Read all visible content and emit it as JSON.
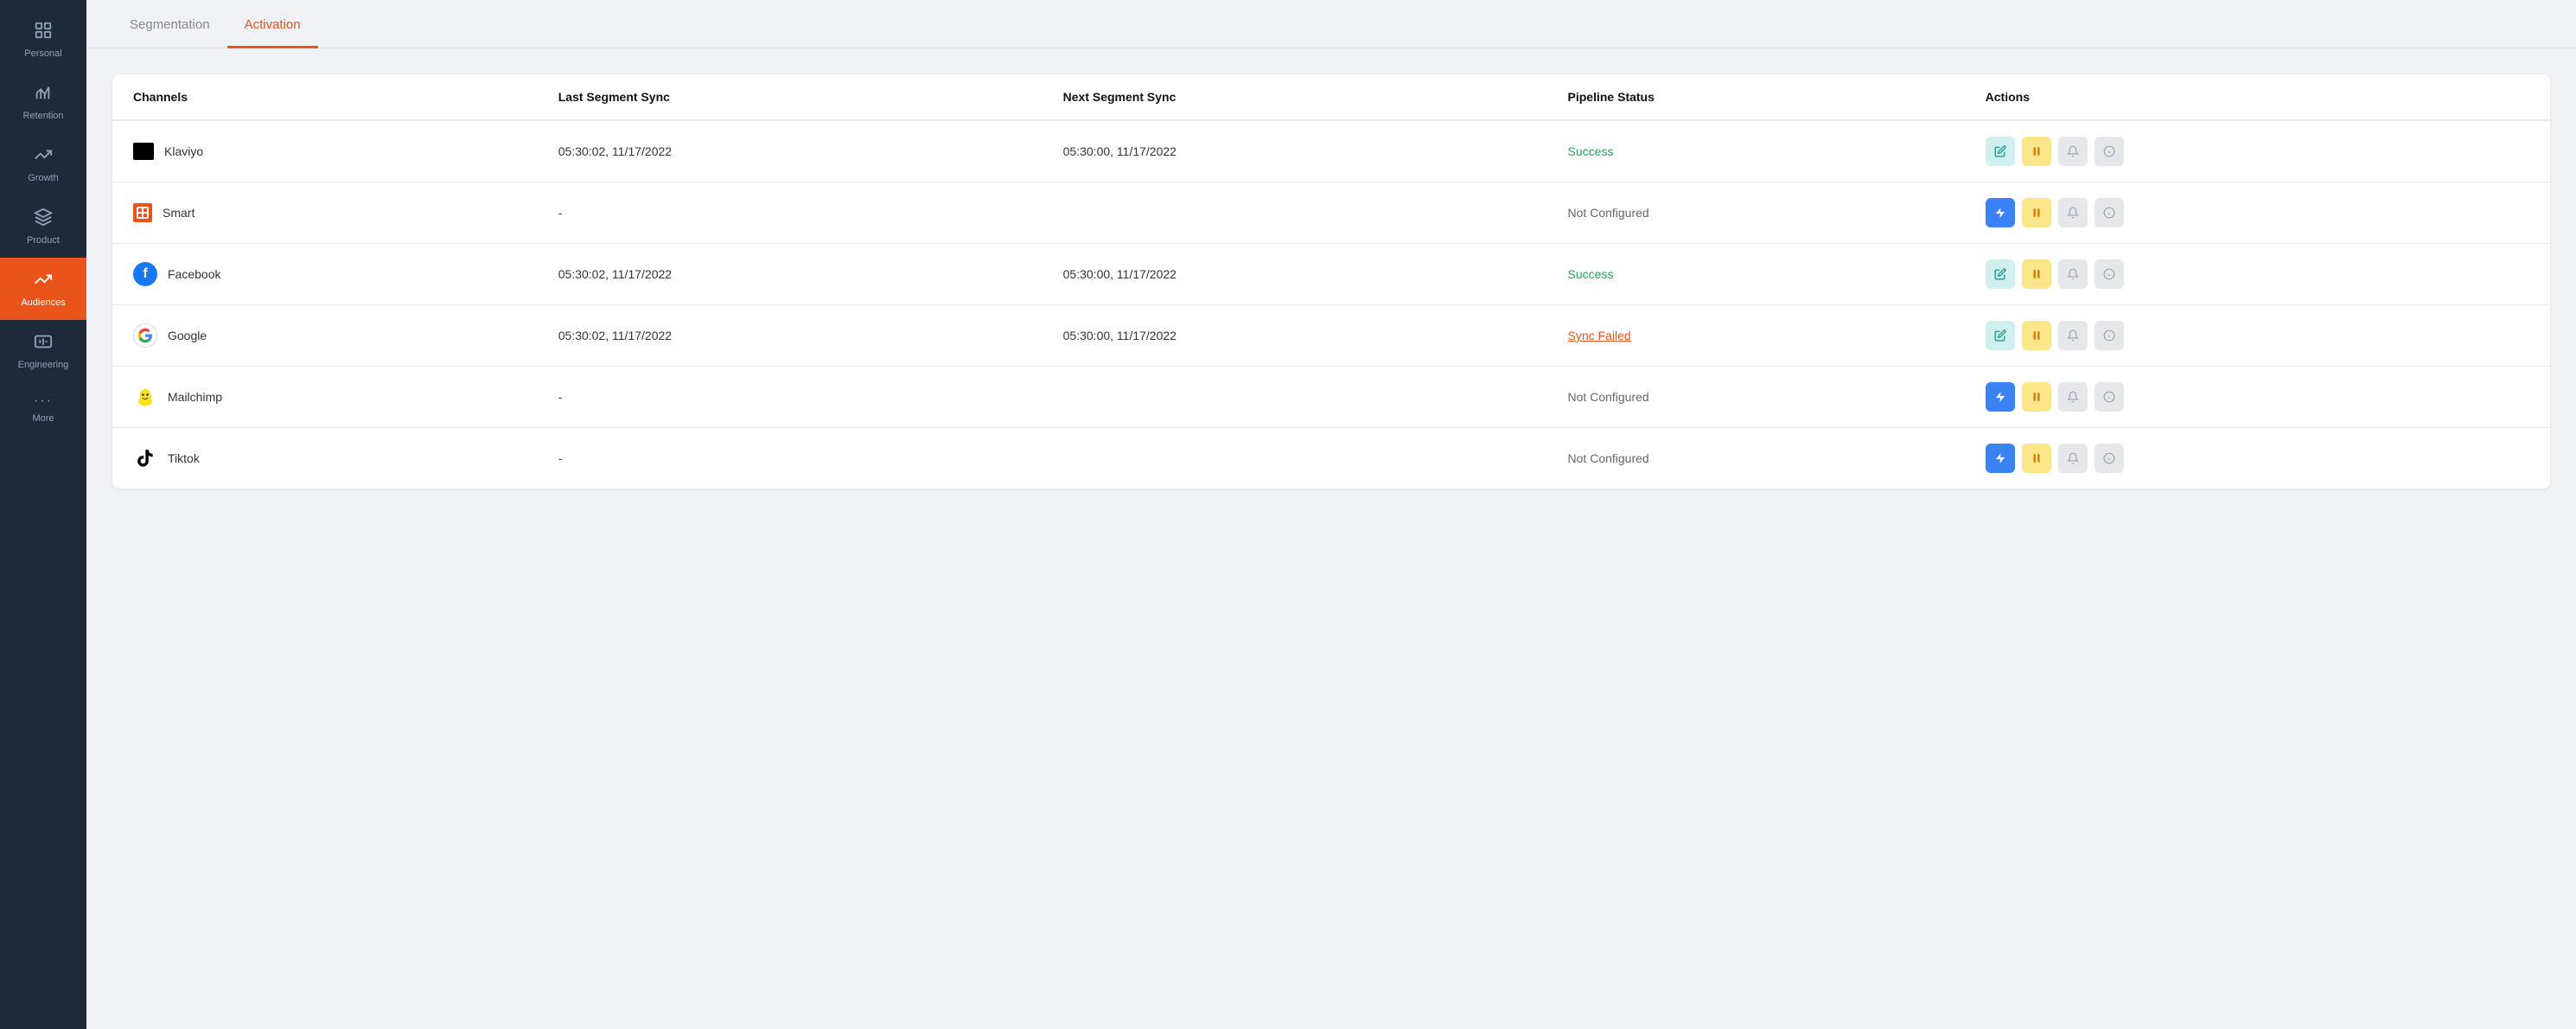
{
  "sidebar": {
    "items": [
      {
        "id": "personal",
        "label": "Personal",
        "icon": "⊞",
        "active": false
      },
      {
        "id": "retention",
        "label": "Retention",
        "icon": "📊",
        "active": false
      },
      {
        "id": "growth",
        "label": "Growth",
        "icon": "📈",
        "active": false
      },
      {
        "id": "product",
        "label": "Product",
        "icon": "🔧",
        "active": false
      },
      {
        "id": "audiences",
        "label": "Audiences",
        "icon": "↗",
        "active": true
      },
      {
        "id": "engineering",
        "label": "Engineering",
        "icon": "⚙",
        "active": false
      },
      {
        "id": "more",
        "label": "More",
        "icon": "···",
        "active": false
      }
    ]
  },
  "tabs": [
    {
      "id": "segmentation",
      "label": "Segmentation",
      "active": false
    },
    {
      "id": "activation",
      "label": "Activation",
      "active": true
    }
  ],
  "table": {
    "columns": [
      {
        "id": "channels",
        "label": "Channels"
      },
      {
        "id": "last_sync",
        "label": "Last Segment Sync"
      },
      {
        "id": "next_sync",
        "label": "Next Segment Sync"
      },
      {
        "id": "pipeline_status",
        "label": "Pipeline Status"
      },
      {
        "id": "actions",
        "label": "Actions"
      }
    ],
    "rows": [
      {
        "channel": "Klaviyo",
        "channel_type": "klaviyo",
        "last_sync": "05:30:02, 11/17/2022",
        "next_sync": "05:30:00, 11/17/2022",
        "status": "Success",
        "status_type": "success",
        "actions": [
          "edit",
          "pause",
          "bell",
          "info"
        ]
      },
      {
        "channel": "Smart",
        "channel_type": "smart",
        "last_sync": "-",
        "next_sync": "",
        "status": "Not Configured",
        "status_type": "not-configured",
        "actions": [
          "bolt",
          "pause",
          "bell",
          "info"
        ]
      },
      {
        "channel": "Facebook",
        "channel_type": "facebook",
        "last_sync": "05:30:02, 11/17/2022",
        "next_sync": "05:30:00, 11/17/2022",
        "status": "Success",
        "status_type": "success",
        "actions": [
          "edit",
          "pause",
          "bell",
          "info"
        ]
      },
      {
        "channel": "Google",
        "channel_type": "google",
        "last_sync": "05:30:02, 11/17/2022",
        "next_sync": "05:30:00, 11/17/2022",
        "status": "Sync Failed",
        "status_type": "failed",
        "actions": [
          "edit",
          "pause",
          "bell",
          "info"
        ]
      },
      {
        "channel": "Mailchimp",
        "channel_type": "mailchimp",
        "last_sync": "-",
        "next_sync": "",
        "status": "Not Configured",
        "status_type": "not-configured",
        "actions": [
          "bolt",
          "pause",
          "bell",
          "info"
        ]
      },
      {
        "channel": "Tiktok",
        "channel_type": "tiktok",
        "last_sync": "-",
        "next_sync": "",
        "status": "Not Configured",
        "status_type": "not-configured",
        "actions": [
          "bolt",
          "pause",
          "bell",
          "info"
        ]
      }
    ]
  },
  "colors": {
    "sidebar_bg": "#1e2a3a",
    "active_bg": "#e8541a",
    "success": "#22a55a",
    "failed": "#e8541a",
    "not_configured": "#666"
  }
}
